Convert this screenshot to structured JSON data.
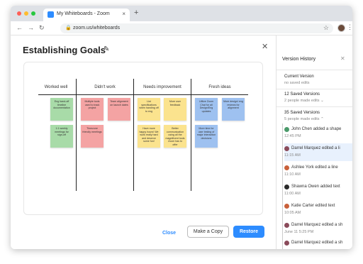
{
  "browser": {
    "tab_title": "My Whiteboards - Zoom",
    "tab_close": "×",
    "new_tab": "+",
    "url": "zoom.us/whiteboards"
  },
  "modal": {
    "title": "Establishing Goals",
    "close_icon": "✕",
    "close_label": "Close",
    "copy_label": "Make a Copy",
    "restore_label": "Restore"
  },
  "board": {
    "columns": [
      "Worked well",
      "Didn't work",
      "Needs improvement",
      "Fresh ideas"
    ],
    "notes": [
      {
        "text": "Eng hand-off timeline documentation",
        "color": "green"
      },
      {
        "text": "1:1 weekly meetings for sign-off",
        "color": "green"
      },
      {
        "text": "Multiple tools used to track project",
        "color": "red"
      },
      {
        "text": "Team alignment on launch dates",
        "color": "red"
      },
      {
        "text": "Timezone friendly meetings",
        "color": "red"
      },
      {
        "text": "List specifications when handing off to eng",
        "color": "yellow"
      },
      {
        "text": "More user feedback",
        "color": "yellow"
      },
      {
        "text": "Have more happy hours! We work really hard and deserve some fun!",
        "color": "yellow"
      },
      {
        "text": "Better communication using all the magnificent tools Zoom has to offer",
        "color": "yellow"
      },
      {
        "text": "Utilize Zoom Chat for all Design/Eng updates",
        "color": "blue"
      },
      {
        "text": "More design/ eng reviews for alignment",
        "color": "blue"
      },
      {
        "text": "More time for user testing of major interaction decisions",
        "color": "blue"
      }
    ]
  },
  "panel": {
    "title": "Version History",
    "close_icon": "✕",
    "current_version": "Current Version",
    "no_saved_edits": "no saved edits",
    "saved_12": "12 Saved Versions",
    "saved_12_sub": "2 people made edits ⌄",
    "saved_35": "35 Saved Versions",
    "saved_35_sub": "5 people made edits ⌃",
    "entries": [
      {
        "text": "John Chen added a shape",
        "time": "12:45 PM",
        "avatar": "#4a9a6a"
      },
      {
        "text": "Darrel Marquez edited a li",
        "time": "11:15 AM",
        "avatar": "#8a4a5a"
      },
      {
        "text": "Ashlee York edited a line",
        "time": "11:10 AM",
        "avatar": "#c9603a"
      },
      {
        "text": "Shawna Owen added text",
        "time": "11:00 AM",
        "avatar": "#2a2a2a"
      },
      {
        "text": "Katie Carter edited text",
        "time": "10:05 AM",
        "avatar": "#c9603a"
      },
      {
        "text": "Darrel Marquez edited a sh",
        "time": "June 11 5:25 PM",
        "avatar": "#8a4a5a"
      },
      {
        "text": "Darrel Marquez edited a sh",
        "time": "",
        "avatar": "#8a4a5a"
      }
    ]
  },
  "colors": {
    "accent": "#2d8cff",
    "light_red": "#ff5f57",
    "light_yellow": "#febc2e",
    "light_green": "#28c840"
  }
}
